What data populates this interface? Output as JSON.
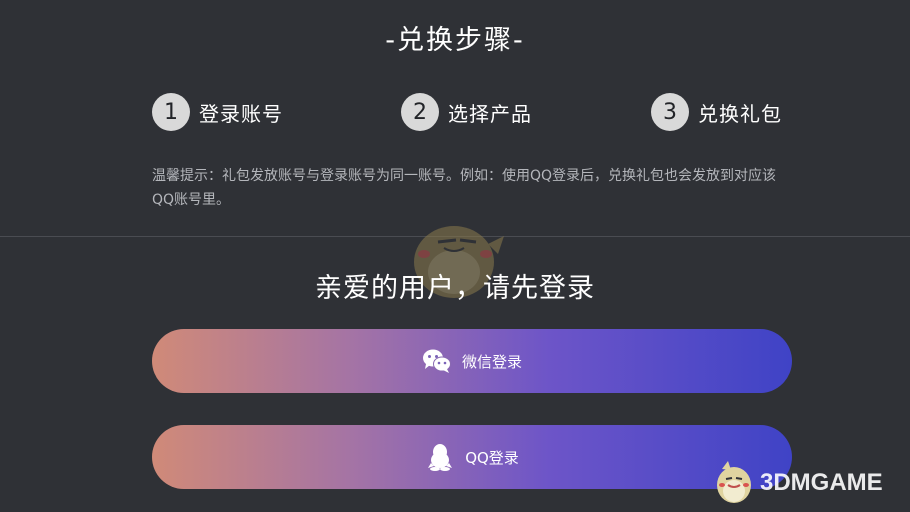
{
  "section_title": "-兑换步骤-",
  "steps": [
    {
      "number": "1",
      "label": "登录账号"
    },
    {
      "number": "2",
      "label": "选择产品"
    },
    {
      "number": "3",
      "label": "兑换礼包"
    }
  ],
  "tip": "温馨提示：礼包发放账号与登录账号为同一账号。例如：使用QQ登录后，兑换礼包也会发放到对应该QQ账号里。",
  "login": {
    "title": "亲爱的用户，请先登录",
    "wechat_label": "微信登录",
    "wechat_icon": "wechat-icon",
    "qq_label": "QQ登录",
    "qq_icon": "qq-penguin-icon"
  },
  "watermark": {
    "text": "3DMGAME"
  },
  "colors": {
    "background": "#2f3136",
    "step_circle": "#d9d9d9",
    "button_gradient_start": "#d08a78",
    "button_gradient_end": "#3f43c6",
    "tip_text": "#b4b6bb"
  }
}
